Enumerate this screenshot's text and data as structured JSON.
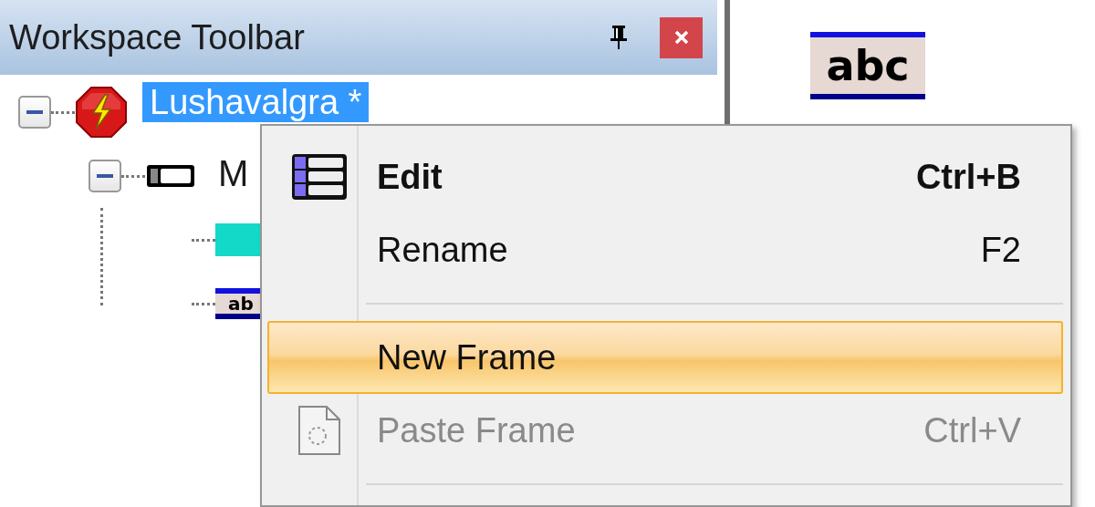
{
  "panel": {
    "title": "Workspace Toolbar",
    "pinned": true
  },
  "tree": [
    {
      "kind": "alarm",
      "label": "Lushavalgra *",
      "selected": true,
      "expanded": true,
      "children": [
        {
          "kind": "toggle",
          "label": "M",
          "selected": false,
          "expanded": true,
          "children": [
            {
              "kind": "bar"
            },
            {
              "kind": "text",
              "badge": "ab"
            }
          ]
        }
      ]
    }
  ],
  "canvas": {
    "widgets": [
      {
        "kind": "text",
        "badge": "abc"
      }
    ]
  },
  "context_menu": {
    "items": [
      {
        "kind": "command",
        "label": "Edit",
        "shortcut": "Ctrl+B",
        "default": true,
        "highlighted": false,
        "disabled": false
      },
      {
        "kind": "command",
        "label": "Rename",
        "shortcut": "F2",
        "default": false,
        "highlighted": false,
        "disabled": false
      },
      {
        "kind": "separator"
      },
      {
        "kind": "command",
        "label": "New Frame",
        "default": false,
        "highlighted": true,
        "disabled": false
      },
      {
        "kind": "command",
        "label": "Paste Frame",
        "shortcut": "Ctrl+V",
        "default": false,
        "highlighted": false,
        "disabled": true
      },
      {
        "kind": "separator"
      }
    ]
  }
}
